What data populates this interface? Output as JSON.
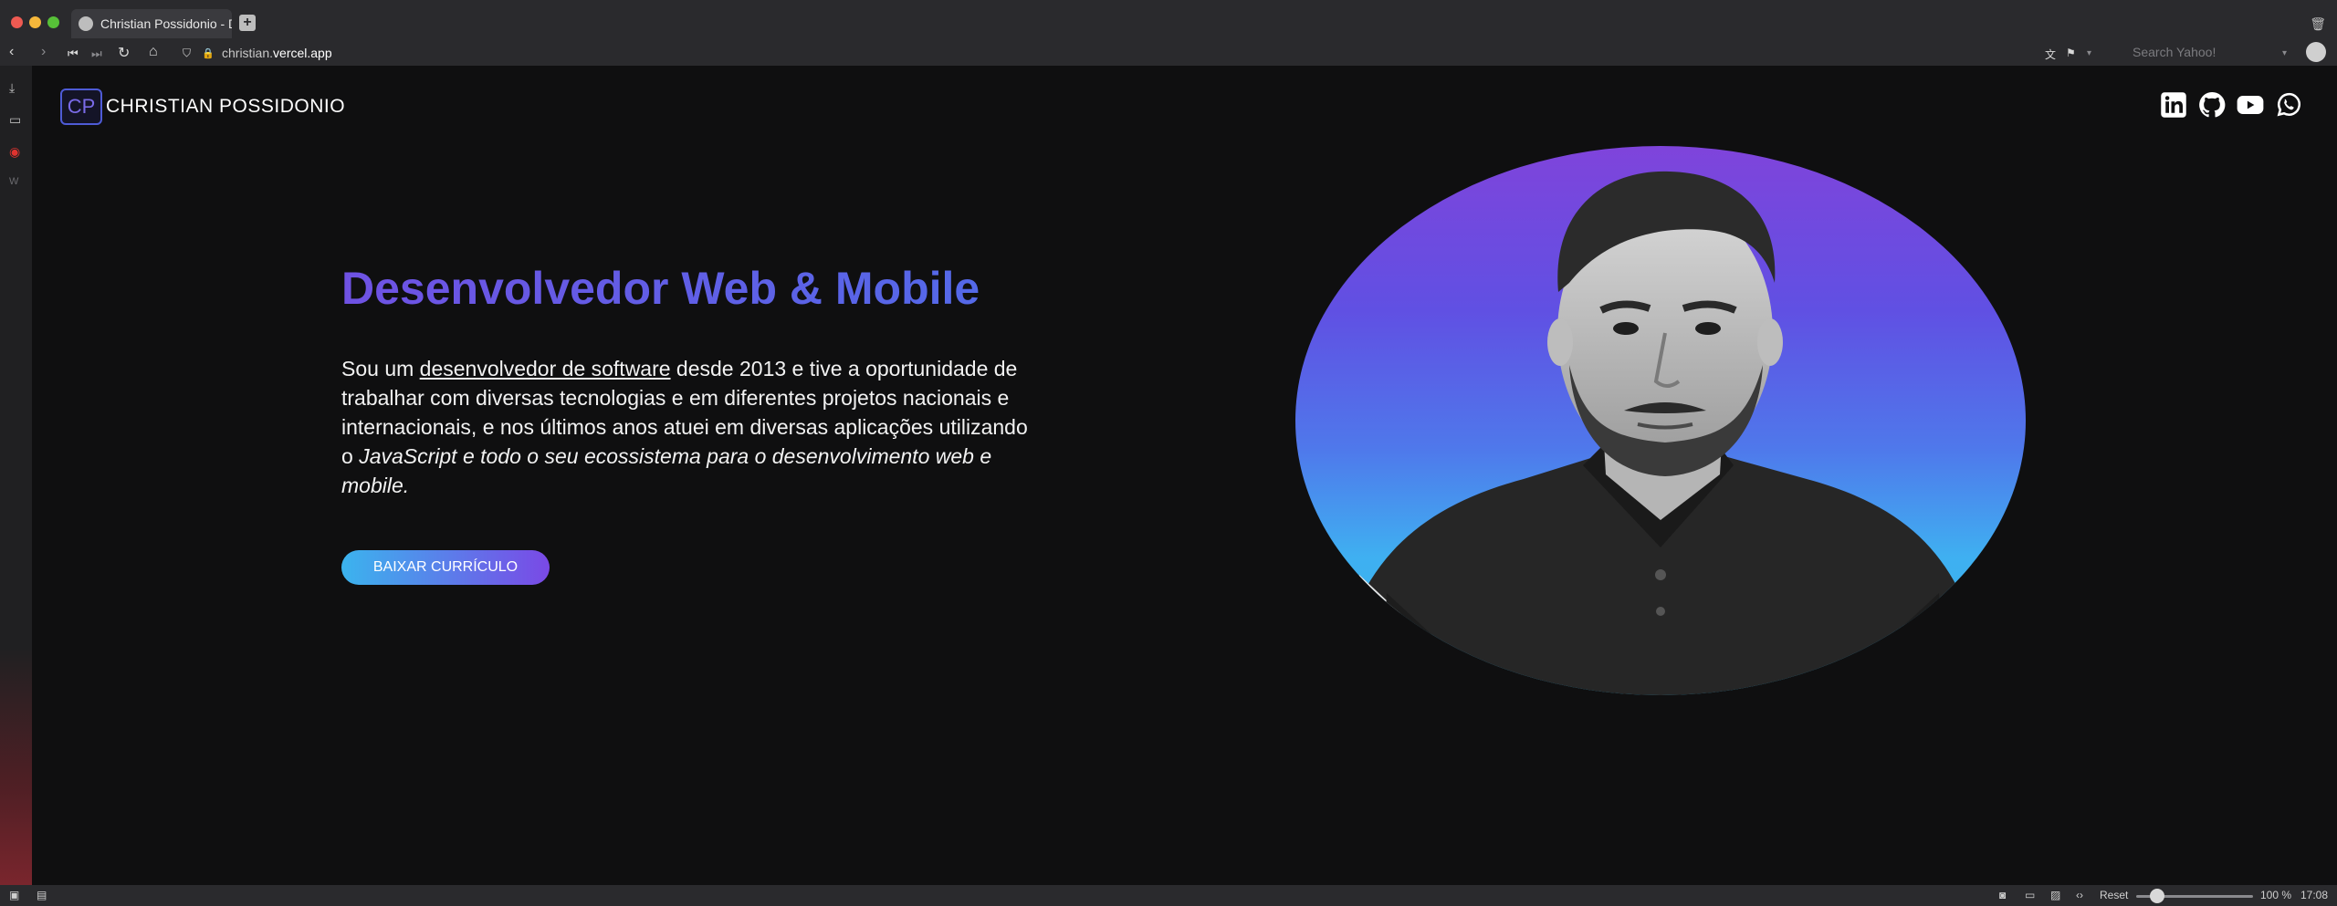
{
  "browser": {
    "tab_title": "Christian Possidonio - Des",
    "url_prefix": "christian.",
    "url_domain": "vercel.app",
    "search_placeholder": "Search Yahoo!",
    "zoom_reset_label": "Reset",
    "zoom_level": "100 %",
    "clock": "17:08"
  },
  "site": {
    "logo_mark": "CP",
    "logo_name": "CHRISTIAN POSSIDONIO",
    "social_icons": [
      "linkedin-icon",
      "github-icon",
      "youtube-icon",
      "whatsapp-icon"
    ]
  },
  "hero": {
    "headline": "Desenvolvedor Web & Mobile",
    "intro_part1": "Sou um ",
    "intro_link": "desenvolvedor de software",
    "intro_part2": " desde 2013 e tive a oportunidade de trabalhar com diversas tecnologias e em diferentes projetos nacionais e internacionais, e nos últimos anos atuei em diversas aplicações utilizando o ",
    "intro_italic": "JavaScript e todo o seu ecossistema para o desenvolvimento web e mobile.",
    "cta_label": "BAIXAR CURRÍCULO"
  },
  "colors": {
    "page_bg": "#0f0f10",
    "accent_purple": "#6f52e3",
    "accent_blue": "#3bb4ee"
  }
}
